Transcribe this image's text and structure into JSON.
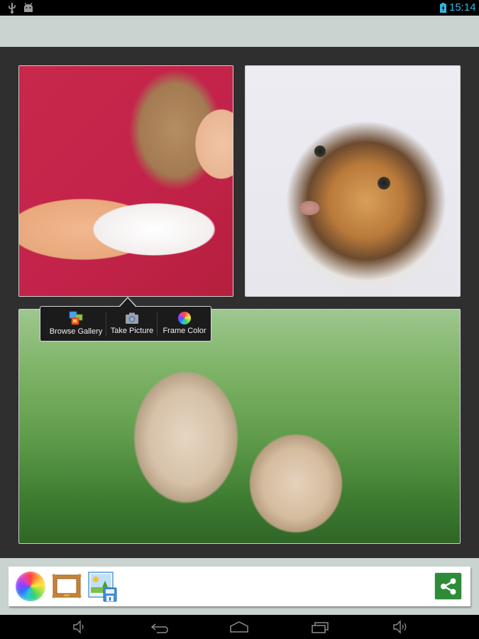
{
  "status_bar": {
    "left_icons": [
      "usb-icon",
      "android-debug-icon"
    ],
    "battery_icon": "battery-charging-icon",
    "time": "15:14",
    "accent_color": "#33b5e5"
  },
  "action_bar": {
    "background_color": "#c9d3cf"
  },
  "collage": {
    "background_color": "#2f2f2f",
    "frame_border_color": "#cfcfcf",
    "cells": [
      {
        "name": "photo-woman-red-background",
        "subject": "woman in red dress with white fur on red background"
      },
      {
        "name": "photo-tiger-cub",
        "subject": "tiger cub face close-up on white background"
      },
      {
        "name": "photo-two-rabbits",
        "subject": "two tan rabbits in green grass"
      }
    ]
  },
  "popup_menu": {
    "items": [
      {
        "label": "Browse Gallery",
        "icon": "gallery-icon"
      },
      {
        "label": "Take Picture",
        "icon": "camera-icon"
      },
      {
        "label": "Frame Color",
        "icon": "color-wheel-icon"
      }
    ]
  },
  "toolbar": {
    "buttons": [
      {
        "name": "background-color-button",
        "icon": "color-wheel-icon"
      },
      {
        "name": "frame-style-button",
        "icon": "picture-frame-icon"
      },
      {
        "name": "save-image-button",
        "icon": "save-image-icon"
      }
    ],
    "share_button": {
      "icon": "share-icon",
      "color": "#2e8b38"
    }
  },
  "nav_bar": {
    "buttons": [
      "volume-down-icon",
      "back-icon",
      "home-icon",
      "recent-apps-icon",
      "volume-up-icon"
    ]
  }
}
